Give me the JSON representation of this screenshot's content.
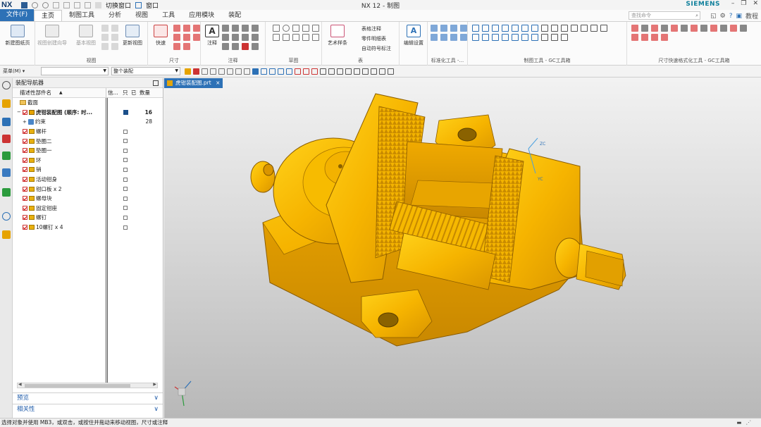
{
  "titlebar": {
    "logo": "NX",
    "switch_window": "切换窗口",
    "window": "窗口",
    "title": "NX 12 - 制图",
    "brand": "SIEMENS"
  },
  "menu": {
    "file": "文件(F)",
    "tabs": [
      "主页",
      "制图工具",
      "分析",
      "视图",
      "工具",
      "应用模块",
      "装配"
    ],
    "search_placeholder": "查找命令",
    "tutorial": "教程"
  },
  "ribbon": {
    "new_sheet": "新建图纸页",
    "base_view": "视图创建向导",
    "base_view2": "基本视图",
    "update_views": "更新视图",
    "view_group": "视图",
    "quick": "快速",
    "dim_group": "尺寸",
    "note": "注释",
    "annotation_group": "注释",
    "sketch_group": "草图",
    "art_style": "艺术样条",
    "tabular_note": "表格注释",
    "parts_list": "零件明细表",
    "auto_balloon": "自动符号标注",
    "table_group": "表",
    "edit_settings": "编辑设置",
    "std_tools": "标准化工具 -...",
    "gc_drafting": "制图工具 - GC工具箱",
    "gc_dim": "尺寸快速格式化工具 - GC工具箱"
  },
  "toolbar2": {
    "menu": "菜单(M)",
    "filter_value": "",
    "scope_value": "整个装配"
  },
  "navigator": {
    "title": "装配导航器",
    "col_name": "描述性部件名",
    "col_info": "信...",
    "col_ro": "只",
    "col_mod": "已",
    "col_count": "数量",
    "rows": [
      {
        "name": "截面",
        "type": "folder",
        "count": ""
      },
      {
        "name": "虎钳装配图 (顺序: 时...",
        "type": "assembly",
        "count": "16"
      },
      {
        "name": "约束",
        "type": "constraint",
        "count": "28"
      },
      {
        "name": "螺杆",
        "type": "part",
        "count": ""
      },
      {
        "name": "垫圈二",
        "type": "part",
        "count": ""
      },
      {
        "name": "垫圈一",
        "type": "part",
        "count": ""
      },
      {
        "name": "环",
        "type": "part",
        "count": ""
      },
      {
        "name": "销",
        "type": "part",
        "count": ""
      },
      {
        "name": "活动钳身",
        "type": "part",
        "count": ""
      },
      {
        "name": "钳口板 x 2",
        "type": "part",
        "count": ""
      },
      {
        "name": "螺母块",
        "type": "part",
        "count": ""
      },
      {
        "name": "固定钳座",
        "type": "part",
        "count": ""
      },
      {
        "name": "螺钉",
        "type": "part",
        "count": ""
      },
      {
        "name": "10螺钉 x 4",
        "type": "part",
        "count": ""
      }
    ],
    "preview": "预览",
    "dependencies": "相关性"
  },
  "graphics": {
    "doc_tab": "虎钳装配图.prt",
    "close": "×",
    "axis_zc": "ZC",
    "axis_yc": "YC"
  },
  "status": {
    "message": "选择对象并使用 MB3，或双击，或按住并拖动来移动视图，尺寸或注释"
  },
  "colors": {
    "accent": "#2d71b6",
    "part_yellow": "#f5b800"
  }
}
